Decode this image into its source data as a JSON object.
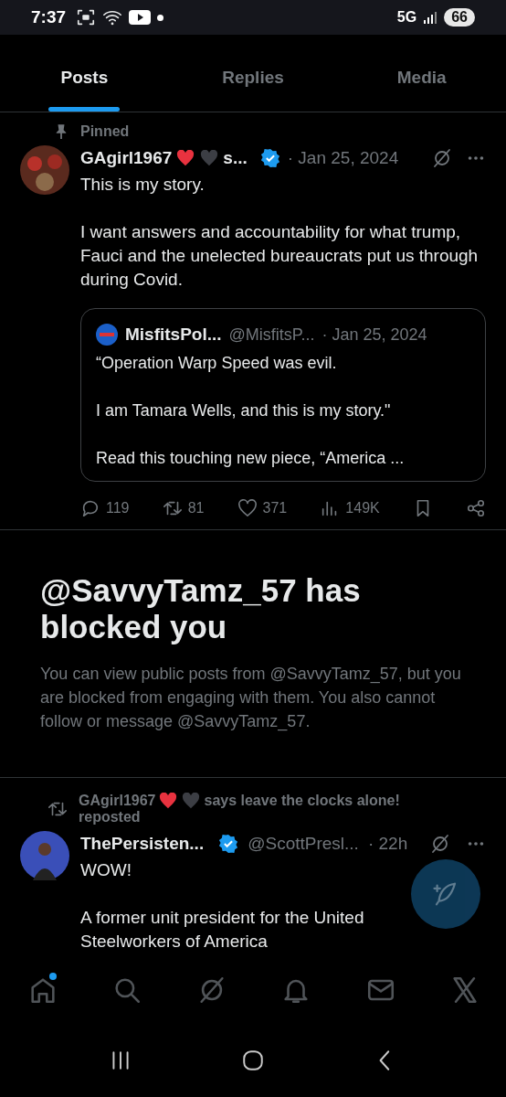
{
  "status_bar": {
    "time": "7:37",
    "network": "5G",
    "battery": "66"
  },
  "tabs": [
    {
      "label": "Posts",
      "selected": true
    },
    {
      "label": "Replies",
      "selected": false
    },
    {
      "label": "Media",
      "selected": false
    }
  ],
  "pinned_post": {
    "pinned_label": "Pinned",
    "name": "GAgirl1967",
    "hearts": [
      {
        "color": "#e8323f"
      },
      {
        "color": "#3c3e44"
      }
    ],
    "name_rest": "s...",
    "verified": true,
    "date": "· Jan 25, 2024",
    "text": "This is my story.\n\nI want answers and accountability for what trump, Fauci and the unelected bureaucrats put us through during Covid.",
    "quote": {
      "name": "MisfitsPol...",
      "handle": "@MisfitsP...",
      "date": "· Jan 25, 2024",
      "text": "“Operation Warp Speed was evil.\n\nI am Tamara Wells, and this is my story.\"\n\nRead this touching new piece, “America ..."
    },
    "stats": {
      "replies": "119",
      "reposts": "81",
      "likes": "371",
      "views": "149K"
    }
  },
  "blocked": {
    "title": "@SavvyTamz_57 has blocked you",
    "text": "You can view public posts from @SavvyTamz_57, but you are blocked from engaging with them. You also cannot follow or message @SavvyTamz_57."
  },
  "repost": {
    "by": "GAgirl1967",
    "hearts": [
      {
        "color": "#e8323f"
      },
      {
        "color": "#3c3e44"
      }
    ],
    "by_rest": "says leave the clocks alone!",
    "label": "reposted",
    "name": "ThePersisten...",
    "verified": true,
    "handle": "@ScottPresl...",
    "time": "· 22h",
    "text": "WOW!\n\nA former unit president for the United Steelworkers of America"
  },
  "bottom_nav": [
    {
      "kind": "home",
      "badge": true
    },
    {
      "kind": "search",
      "badge": false
    },
    {
      "kind": "grok",
      "badge": false
    },
    {
      "kind": "bell",
      "badge": false
    },
    {
      "kind": "mail",
      "badge": false
    },
    {
      "kind": "x",
      "badge": false
    }
  ]
}
